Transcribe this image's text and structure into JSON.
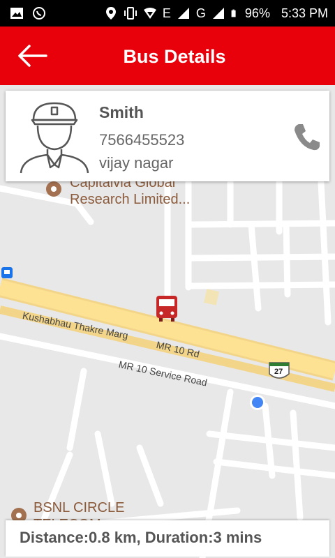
{
  "status_bar": {
    "network_letters": "E",
    "network_letters2": "G",
    "battery": "96%",
    "time": "5:33 PM"
  },
  "app_bar": {
    "title": "Bus Details",
    "back_icon": "arrow-left-icon"
  },
  "driver": {
    "name": "Smith",
    "phone": "7566455523",
    "location": "vijay nagar",
    "call_icon": "phone-icon"
  },
  "map": {
    "labels": {
      "poi_1_line1": "Capitalvia Global",
      "poi_1_line2": "Research Limited...",
      "poi_2_line1": "BSNL CIRCLE",
      "poi_2_line2": "TELECOM",
      "road_1": "Kushabhau Thakre Marg",
      "road_2": "MR 10 Rd",
      "road_3": "MR 10 Service Road",
      "highway_shield": "27"
    }
  },
  "trip_info": {
    "text": "Distance:0.8 km, Duration:3 mins"
  },
  "colors": {
    "app_bar": "#e8000b",
    "bus_marker": "#c62828",
    "location_dot": "#4285f4"
  }
}
